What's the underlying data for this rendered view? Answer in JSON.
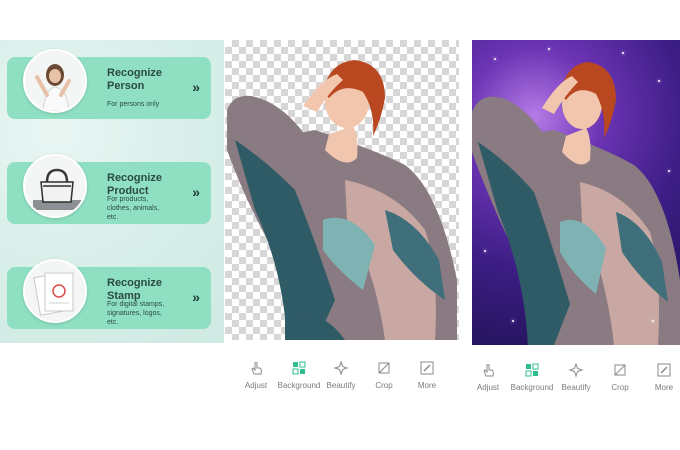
{
  "features": [
    {
      "title_1": "Recognize",
      "title_2": "Person",
      "subtitle": "For persons only",
      "thumb_icon": "woman-portrait-icon",
      "chevron": "»"
    },
    {
      "title_1": "Recognize",
      "title_2": "Product",
      "subtitle_1": "For products,",
      "subtitle_2": "clothes, animals,",
      "subtitle_3": "etc.",
      "thumb_icon": "handbag-icon",
      "chevron": "»"
    },
    {
      "title_1": "Recognize",
      "title_2": "Stamp",
      "subtitle_1": "For digital stamps,",
      "subtitle_2": "signatures, logos,",
      "subtitle_3": "etc.",
      "thumb_icon": "stamp-paper-icon",
      "chevron": "»"
    }
  ],
  "toolbar_mid": {
    "adjust": "Adjust",
    "background": "Background",
    "beautify": "Beautify",
    "crop": "Crop",
    "more": "More"
  },
  "toolbar_right": {
    "adjust": "Adjust",
    "background": "Background",
    "beautify": "Beautify",
    "crop": "Crop",
    "more": "More"
  },
  "colors": {
    "card": "#8fe0c2",
    "panel": "#dbf0eb",
    "galaxy": "#3e1e86",
    "checker": "#d6d6d6",
    "toolbar_text": "#7b7b7b"
  }
}
